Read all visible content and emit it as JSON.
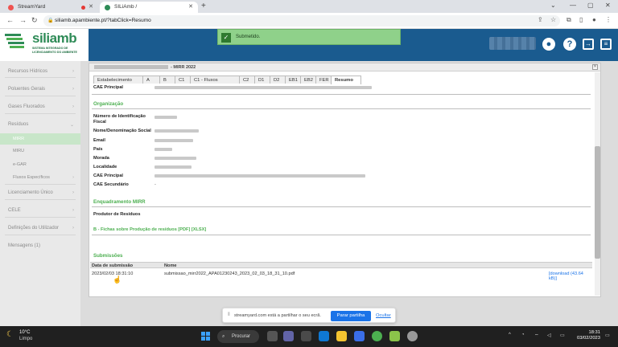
{
  "browser": {
    "tabs": [
      {
        "label": "StreamYard",
        "active": false
      },
      {
        "label": "SILiAmb /",
        "active": true
      }
    ],
    "url": "siliamb.apambiente.pt/?tabClick=Resumo"
  },
  "header": {
    "logo_text": "siliamb",
    "logo_sub": "SISTEMA INTEGRADO DE LICENCIAMENTO DO AMBIENTE",
    "toast": "Submetido."
  },
  "sidebar": {
    "items": [
      {
        "label": "Recursos Hídricos",
        "chev": "›"
      },
      {
        "label": "Poluentes Gerais",
        "chev": "›"
      },
      {
        "label": "Gases Fluorados",
        "chev": "›"
      },
      {
        "label": "Resíduos",
        "chev": "⌄"
      },
      {
        "label": "MIRR",
        "sub": true,
        "selected": true
      },
      {
        "label": "MIRU",
        "sub": true
      },
      {
        "label": "e-GAR",
        "sub": true
      },
      {
        "label": "Fluxos Específicos",
        "sub": true,
        "chev": "›"
      },
      {
        "label": "Licenciamento Único",
        "chev": "›"
      },
      {
        "label": "CELE",
        "chev": "›"
      },
      {
        "label": "Definições do Utilizador",
        "chev": "›"
      },
      {
        "label": "Mensagens (1)",
        "chev": ""
      }
    ]
  },
  "panel": {
    "title_suffix": "- MIRR 2022",
    "tabs": [
      "Estabelecimento",
      "A",
      "B",
      "C1",
      "C1 - Fluxos",
      "C2",
      "D1",
      "D2",
      "EB1",
      "EB2",
      "FER",
      "Resumo"
    ],
    "cae_principal_top": "CAE Principal",
    "org_title": "Organização",
    "fields": [
      "Número de Identificação Fiscal",
      "Nome/Denominação Social",
      "Email",
      "País",
      "Morada",
      "Localidade",
      "CAE Principal",
      "CAE Secundário"
    ],
    "cae_secundario_value": "-",
    "mirr_title": "Enquadramento MIRR",
    "mirr_value": "Produtor de Resíduos",
    "fichas_prefix": "B - Fichas sobre Produção de resíduos",
    "fichas_pdf": "[PDF]",
    "fichas_xlsx": "[XLSX]",
    "subm_title": "Submissões",
    "table": {
      "headers": [
        "Data de submissão",
        "Nome"
      ],
      "rows": [
        {
          "date": "2023/02/03 18:31:10",
          "name": "submissao_mirr2022_APA01230243_2023_02_03_18_31_10.pdf",
          "download": "[download (43.64 kB)]"
        }
      ]
    }
  },
  "share_bar": {
    "text": "streamyard.com está a partilhar o seu ecrã.",
    "stop": "Parar partilha",
    "hide": "Ocultar"
  },
  "taskbar": {
    "temp": "10°C",
    "condition": "Limpo",
    "search": "Procurar",
    "time": "18:31",
    "date": "03/02/2023"
  }
}
